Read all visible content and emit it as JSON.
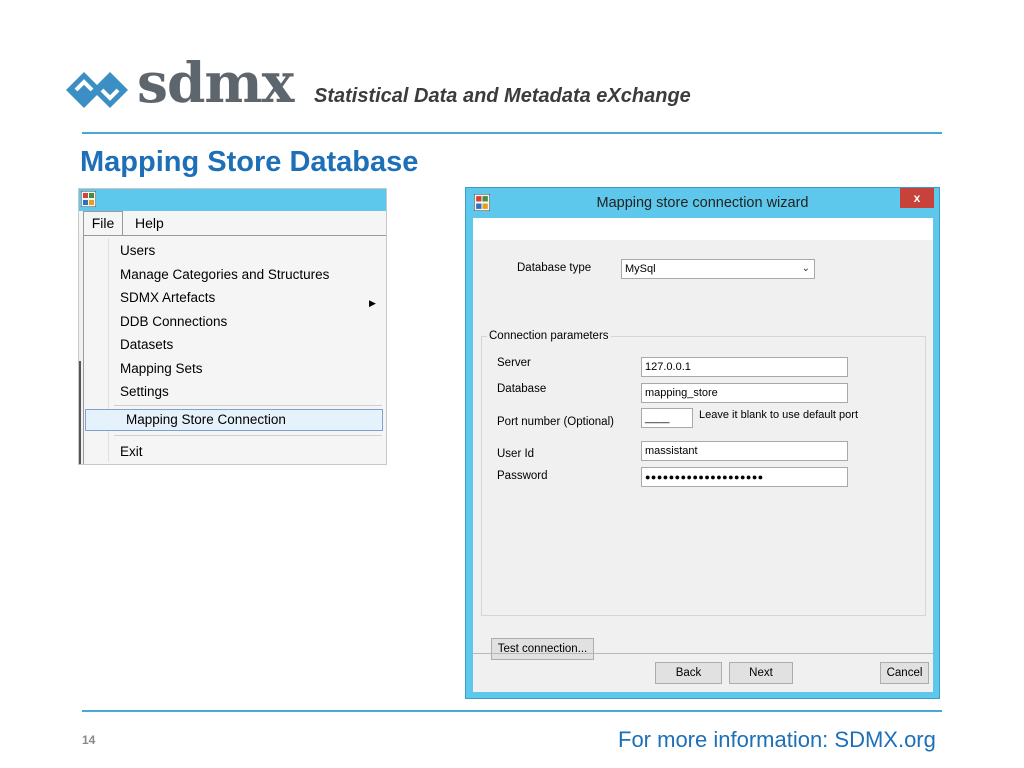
{
  "header": {
    "logo_text": "sdmx",
    "tagline": "Statistical Data and Metadata eXchange"
  },
  "page_title": "Mapping Store Database",
  "menu": {
    "file_label": "File",
    "help_label": "Help",
    "items": [
      "Users",
      "Manage Categories and Structures",
      "SDMX Artefacts",
      "DDB Connections",
      "Datasets",
      "Mapping Sets",
      "Settings",
      "Mapping Store Connection",
      "Exit"
    ],
    "highlighted_item": "Mapping Store Connection",
    "submenu_item": "SDMX Artefacts"
  },
  "wizard": {
    "title": "Mapping store connection wizard",
    "close_label": "x",
    "database_type_label": "Database type",
    "database_type_value": "MySql",
    "connection_group_label": "Connection parameters",
    "server_label": "Server",
    "server_value": "127.0.0.1",
    "database_label": "Database",
    "database_value": "mapping_store",
    "port_label": "Port number (Optional)",
    "port_value": "____",
    "port_hint": "Leave it blank to use default port",
    "user_label": "User Id",
    "user_value": "massistant",
    "password_label": "Password",
    "password_value": "●●●●●●●●●●●●●●●●●●●●",
    "test_button": "Test connection...",
    "back_button": "Back",
    "next_button": "Next",
    "cancel_button": "Cancel"
  },
  "footer": {
    "page_number": "14",
    "info_text": "For more information: SDMX.org"
  },
  "colors": {
    "brand_blue": "#1d6fb8",
    "title_bar": "#5ec8ec",
    "close_red": "#c7423a"
  }
}
